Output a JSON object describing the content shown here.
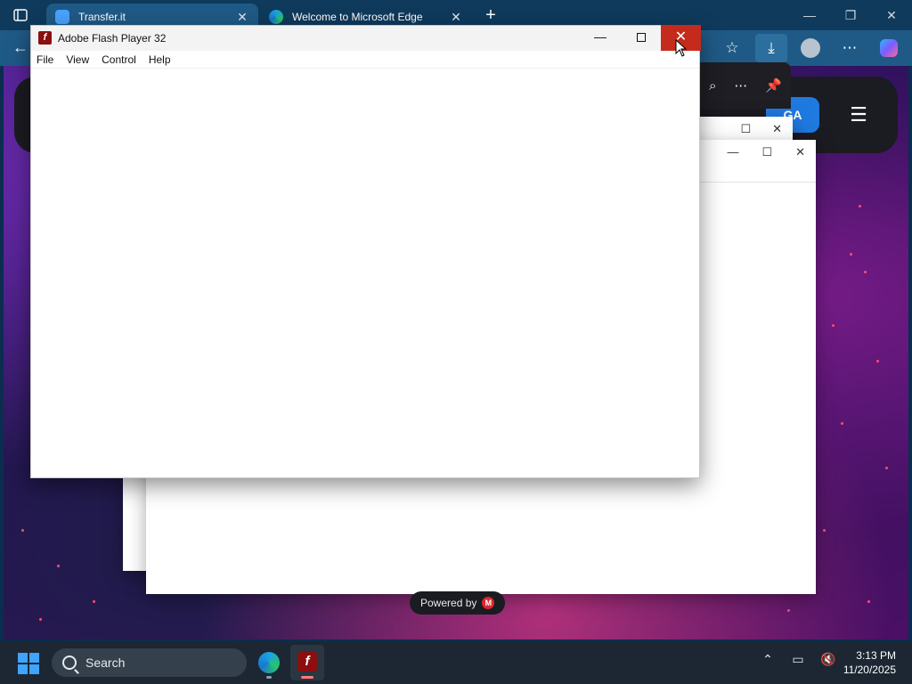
{
  "browser": {
    "tabs": [
      {
        "title": "Transfer.it",
        "active": true
      },
      {
        "title": "Welcome to Microsoft Edge",
        "active": false
      }
    ],
    "new_tab": "+"
  },
  "site": {
    "button_label": "GA",
    "powered_by": "Powered by",
    "powered_logo": "M"
  },
  "flash_window": {
    "title": "Adobe Flash Player 32",
    "menu": [
      "File",
      "View",
      "Control",
      "Help"
    ]
  },
  "taskbar": {
    "search_label": "Search",
    "time": "3:13 PM",
    "date": "11/20/2025"
  },
  "colors": {
    "close_red": "#c42b1c",
    "flash_brand": "#8b0f0f",
    "edge_accent": "#1f5a86"
  }
}
